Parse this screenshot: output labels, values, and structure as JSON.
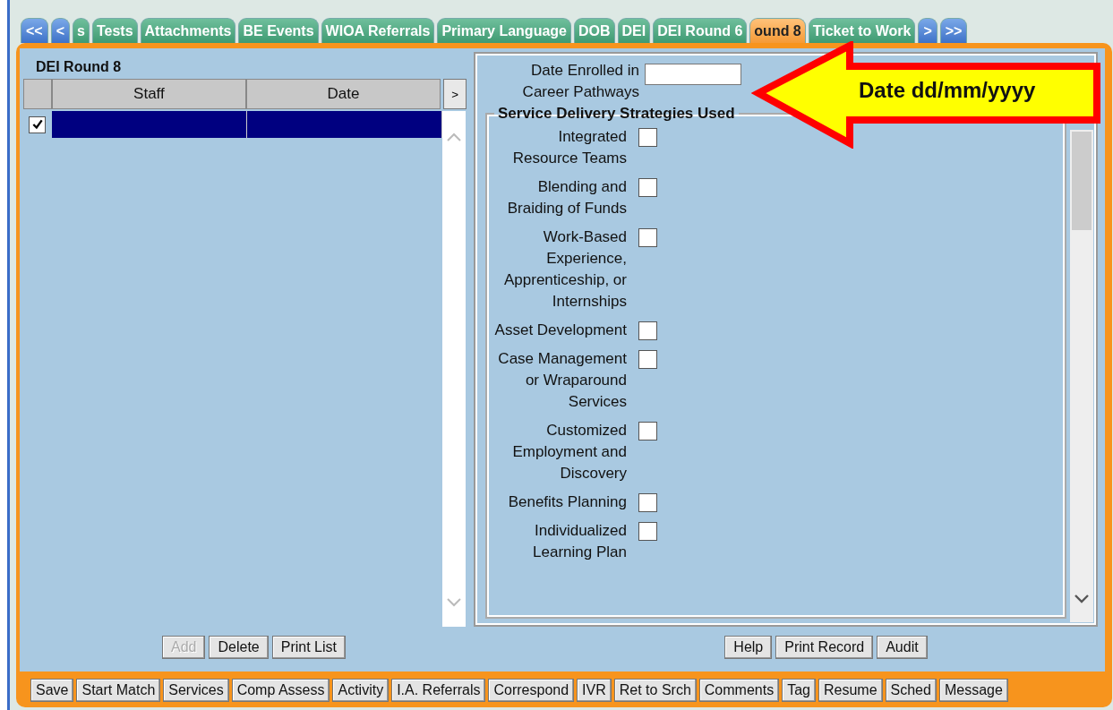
{
  "tabs": [
    {
      "label": "<<",
      "kind": "nav",
      "selected": false
    },
    {
      "label": "<",
      "kind": "nav",
      "selected": false
    },
    {
      "label": "s",
      "kind": "tab",
      "selected": false
    },
    {
      "label": "Tests",
      "kind": "tab",
      "selected": false
    },
    {
      "label": "Attachments",
      "kind": "tab",
      "selected": false
    },
    {
      "label": "BE Events",
      "kind": "tab",
      "selected": false
    },
    {
      "label": "WIOA Referrals",
      "kind": "tab",
      "selected": false
    },
    {
      "label": "Primary Language",
      "kind": "tab",
      "selected": false
    },
    {
      "label": "DOB",
      "kind": "tab",
      "selected": false
    },
    {
      "label": "DEI",
      "kind": "tab",
      "selected": false
    },
    {
      "label": "DEI Round 6",
      "kind": "tab",
      "selected": false
    },
    {
      "label": "ound 8",
      "kind": "tab",
      "selected": true
    },
    {
      "label": "Ticket to Work",
      "kind": "tab",
      "selected": false
    },
    {
      "label": ">",
      "kind": "nav",
      "selected": false
    },
    {
      "label": ">>",
      "kind": "nav",
      "selected": false
    }
  ],
  "list": {
    "title": "DEI Round 8",
    "columns": [
      "Staff",
      "Date"
    ],
    "expand": ">",
    "rows": [
      {
        "checked": true,
        "selected": true
      }
    ]
  },
  "list_buttons": [
    {
      "label": "Add",
      "disabled": true
    },
    {
      "label": "Delete",
      "disabled": false
    },
    {
      "label": "Print List",
      "disabled": false
    }
  ],
  "form": {
    "date_label": "Date Enrolled in Career Pathways",
    "group_title": "Service Delivery Strategies Used",
    "items": [
      {
        "label": "Integrated Resource Teams",
        "checked": false
      },
      {
        "label": "Blending and Braiding of Funds",
        "checked": false
      },
      {
        "label": "Work-Based Experience, Apprenticeship, or Internships",
        "checked": false
      },
      {
        "label": "Asset Development",
        "checked": false
      },
      {
        "label": "Case Management or Wraparound Services",
        "checked": false
      },
      {
        "label": "Customized Employment and Discovery",
        "checked": false
      },
      {
        "label": "Benefits Planning",
        "checked": false
      },
      {
        "label": "Individualized Learning Plan",
        "checked": false
      }
    ]
  },
  "form_buttons": [
    "Help",
    "Print Record",
    "Audit"
  ],
  "toolbar": [
    "Save",
    "Start Match",
    "Services",
    "Comp Assess",
    "Activity",
    "I.A. Referrals",
    "Correspond",
    "IVR",
    "Ret to Srch",
    "Comments",
    "Tag",
    "Resume",
    "Sched",
    "Message"
  ],
  "callout": {
    "text": "Date dd/mm/yyyy"
  }
}
